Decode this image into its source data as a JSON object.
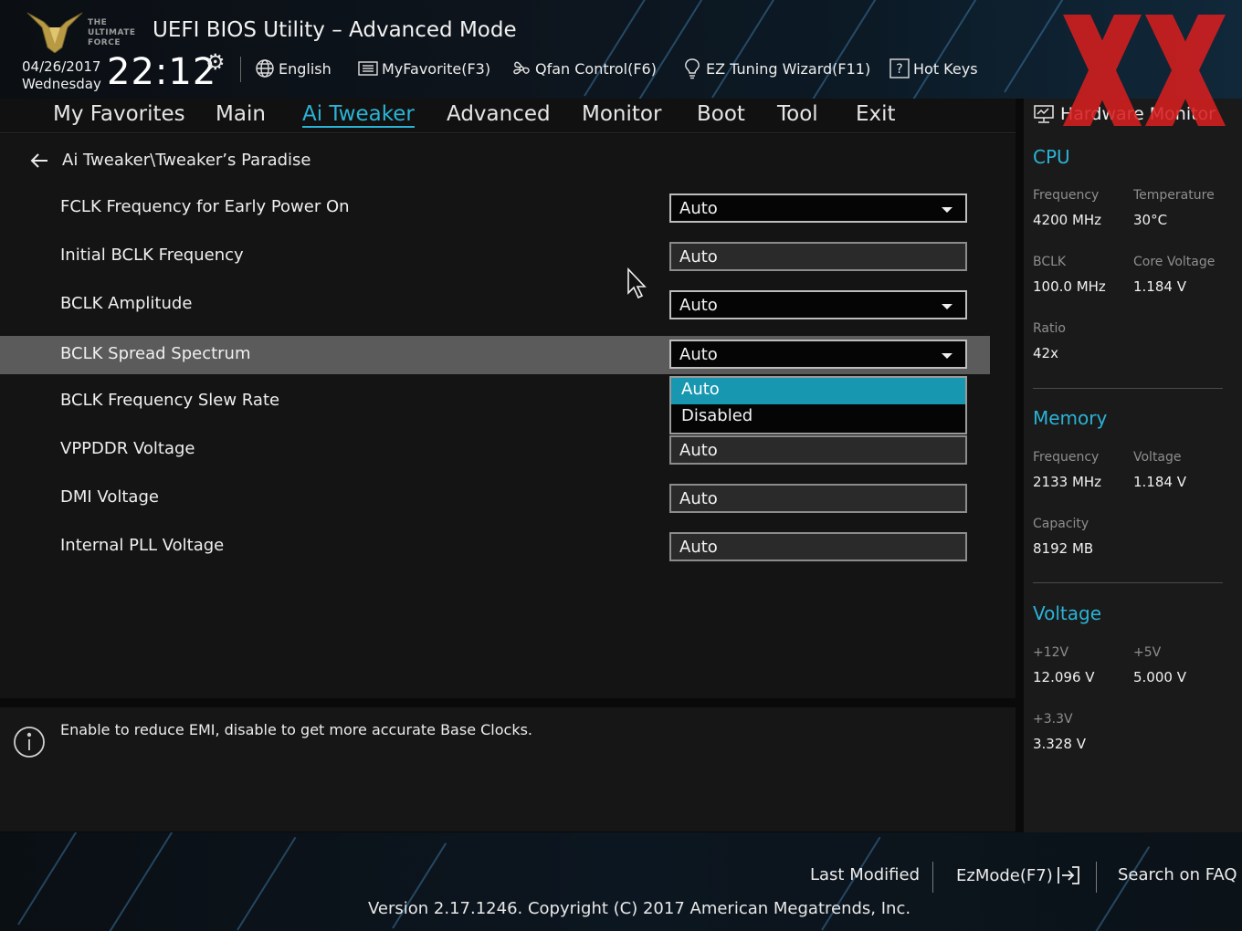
{
  "header": {
    "title": "UEFI BIOS Utility – Advanced Mode",
    "logo_text": [
      "THE",
      "ULTIMATE",
      "FORCE"
    ],
    "date": "04/26/2017",
    "weekday": "Wednesday",
    "time": "22:12",
    "tools": [
      {
        "label": "English",
        "icon": "globe-icon"
      },
      {
        "label": "MyFavorite(F3)",
        "icon": "favorite-list-icon"
      },
      {
        "label": "Qfan Control(F6)",
        "icon": "fan-icon"
      },
      {
        "label": "EZ Tuning Wizard(F11)",
        "icon": "lightbulb-icon"
      },
      {
        "label": "Hot Keys",
        "icon": "question-icon"
      }
    ]
  },
  "nav": {
    "tabs": [
      "My Favorites",
      "Main",
      "Ai Tweaker",
      "Advanced",
      "Monitor",
      "Boot",
      "Tool",
      "Exit"
    ],
    "active": "Ai Tweaker"
  },
  "main": {
    "breadcrumb": "Ai Tweaker\\Tweaker’s Paradise",
    "settings": [
      {
        "label": "FCLK Frequency for Early Power On",
        "value": "Auto",
        "type": "dropdown"
      },
      {
        "label": "Initial BCLK Frequency",
        "value": "Auto",
        "type": "input"
      },
      {
        "label": "BCLK Amplitude",
        "value": "Auto",
        "type": "dropdown"
      },
      {
        "label": "BCLK Spread Spectrum",
        "value": "Auto",
        "type": "dropdown",
        "selected": true
      },
      {
        "label": "BCLK Frequency Slew Rate",
        "value": "",
        "type": "hidden"
      },
      {
        "label": "VPPDDR Voltage",
        "value": "Auto",
        "type": "input"
      },
      {
        "label": "DMI Voltage",
        "value": "Auto",
        "type": "input"
      },
      {
        "label": "Internal PLL Voltage",
        "value": "Auto",
        "type": "input"
      }
    ],
    "dropdown_options": [
      "Auto",
      "Disabled"
    ],
    "dropdown_highlighted": "Auto"
  },
  "help": {
    "text": "Enable to reduce EMI, disable to get more accurate Base Clocks."
  },
  "hardware_monitor": {
    "title": "Hardware Monitor",
    "cpu": {
      "heading": "CPU",
      "frequency_label": "Frequency",
      "frequency": "4200 MHz",
      "temperature_label": "Temperature",
      "temperature": "30°C",
      "bclk_label": "BCLK",
      "bclk": "100.0 MHz",
      "core_voltage_label": "Core Voltage",
      "core_voltage": "1.184 V",
      "ratio_label": "Ratio",
      "ratio": "42x"
    },
    "memory": {
      "heading": "Memory",
      "frequency_label": "Frequency",
      "frequency": "2133 MHz",
      "voltage_label": "Voltage",
      "voltage": "1.184 V",
      "capacity_label": "Capacity",
      "capacity": "8192 MB"
    },
    "voltage": {
      "heading": "Voltage",
      "v12_label": "+12V",
      "v12": "12.096 V",
      "v5_label": "+5V",
      "v5": "5.000 V",
      "v33_label": "+3.3V",
      "v33": "3.328 V"
    }
  },
  "footer": {
    "last_modified": "Last Modified",
    "ezmode": "EzMode(F7)",
    "search_faq": "Search on FAQ",
    "version": "Version 2.17.1246. Copyright (C) 2017 American Megatrends, Inc."
  },
  "colors": {
    "accent": "#2bb3d6",
    "highlight": "#1797b0",
    "selected_row": "#5b5b5b",
    "watermark": "#d61f1f"
  }
}
